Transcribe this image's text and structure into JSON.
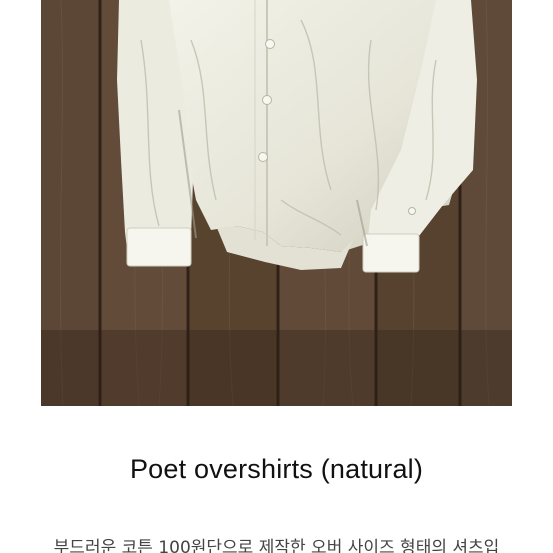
{
  "product": {
    "image_alt": "shirt-photo",
    "title": "Poet overshirts (natural)",
    "description": "부드러운 코튼 100원단으로 제작한 오버 사이즈 형태의 셔츠입"
  },
  "colors": {
    "background": "#ffffff",
    "title_text": "#111111",
    "description_text": "#444444"
  }
}
